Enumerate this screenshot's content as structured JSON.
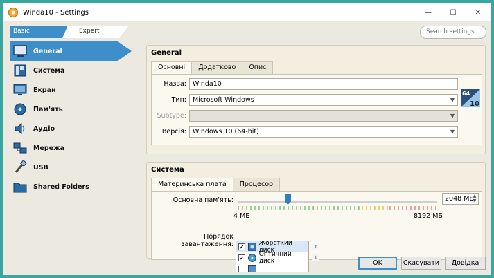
{
  "window": {
    "title": "Winda10 - Settings",
    "controls": {
      "minimize": "—",
      "maximize": "☐",
      "close": "✕"
    }
  },
  "mode_tabs": {
    "basic": "Basic",
    "expert": "Expert"
  },
  "search": {
    "placeholder": "Search settings"
  },
  "sidebar": {
    "items": [
      {
        "label": "General",
        "icon": "general-icon",
        "active": true
      },
      {
        "label": "Система",
        "icon": "system-icon"
      },
      {
        "label": "Екран",
        "icon": "display-icon"
      },
      {
        "label": "Пам'ять",
        "icon": "storage-icon"
      },
      {
        "label": "Аудіо",
        "icon": "audio-icon"
      },
      {
        "label": "Мережа",
        "icon": "network-icon"
      },
      {
        "label": "USB",
        "icon": "usb-icon"
      },
      {
        "label": "Shared Folders",
        "icon": "shared-folders-icon"
      }
    ]
  },
  "general": {
    "title": "General",
    "tabs": [
      "Основні",
      "Додатково",
      "Опис"
    ],
    "name_label": "Назва:",
    "name_value": "Winda10",
    "type_label": "Тип:",
    "type_value": "Microsoft Windows",
    "subtype_label": "Subtype:",
    "subtype_value": "",
    "version_label": "Версія:",
    "version_value": "Windows 10 (64-bit)",
    "os_badge": {
      "top": "64",
      "bottom": "10"
    }
  },
  "system": {
    "title": "Система",
    "tabs": [
      "Материнська плата",
      "Процесор"
    ],
    "memory_label": "Основна пам'ять:",
    "memory_value": "2048 МБ",
    "memory_fraction": 0.25,
    "memory_min": "4 МБ",
    "memory_max": "8192 МБ",
    "boot_label": "Порядок завантаження:",
    "boot_items": [
      {
        "label": "Жорсткий диск",
        "checked": true
      },
      {
        "label": "Оптичний диск",
        "checked": true
      },
      {
        "label": "",
        "checked": false
      }
    ]
  },
  "buttons": {
    "ok": "OK",
    "cancel": "Скасувати",
    "help": "Довідка"
  },
  "colors": {
    "accent": "#3d8ec9",
    "background": "#3aa6a0"
  }
}
